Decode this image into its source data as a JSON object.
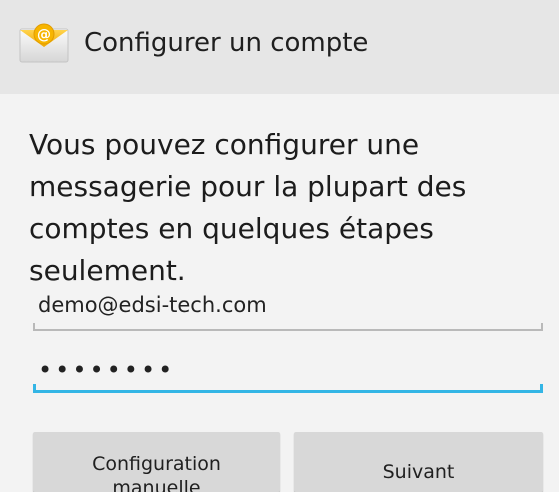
{
  "app_bar": {
    "icon": "email-app-icon",
    "title": "Configurer un compte",
    "background": "#e6e6e6"
  },
  "intro_text": "Vous pouvez configurer une messagerie pour la plupart des comptes en quelques étapes seulement.",
  "form": {
    "email_value": "demo@edsi-tech.com",
    "password_value": "••••••••",
    "focus_color": "#33b5e5"
  },
  "buttons": {
    "manual_label": "Configuration\nmanuelle",
    "next_label": "Suivant"
  }
}
